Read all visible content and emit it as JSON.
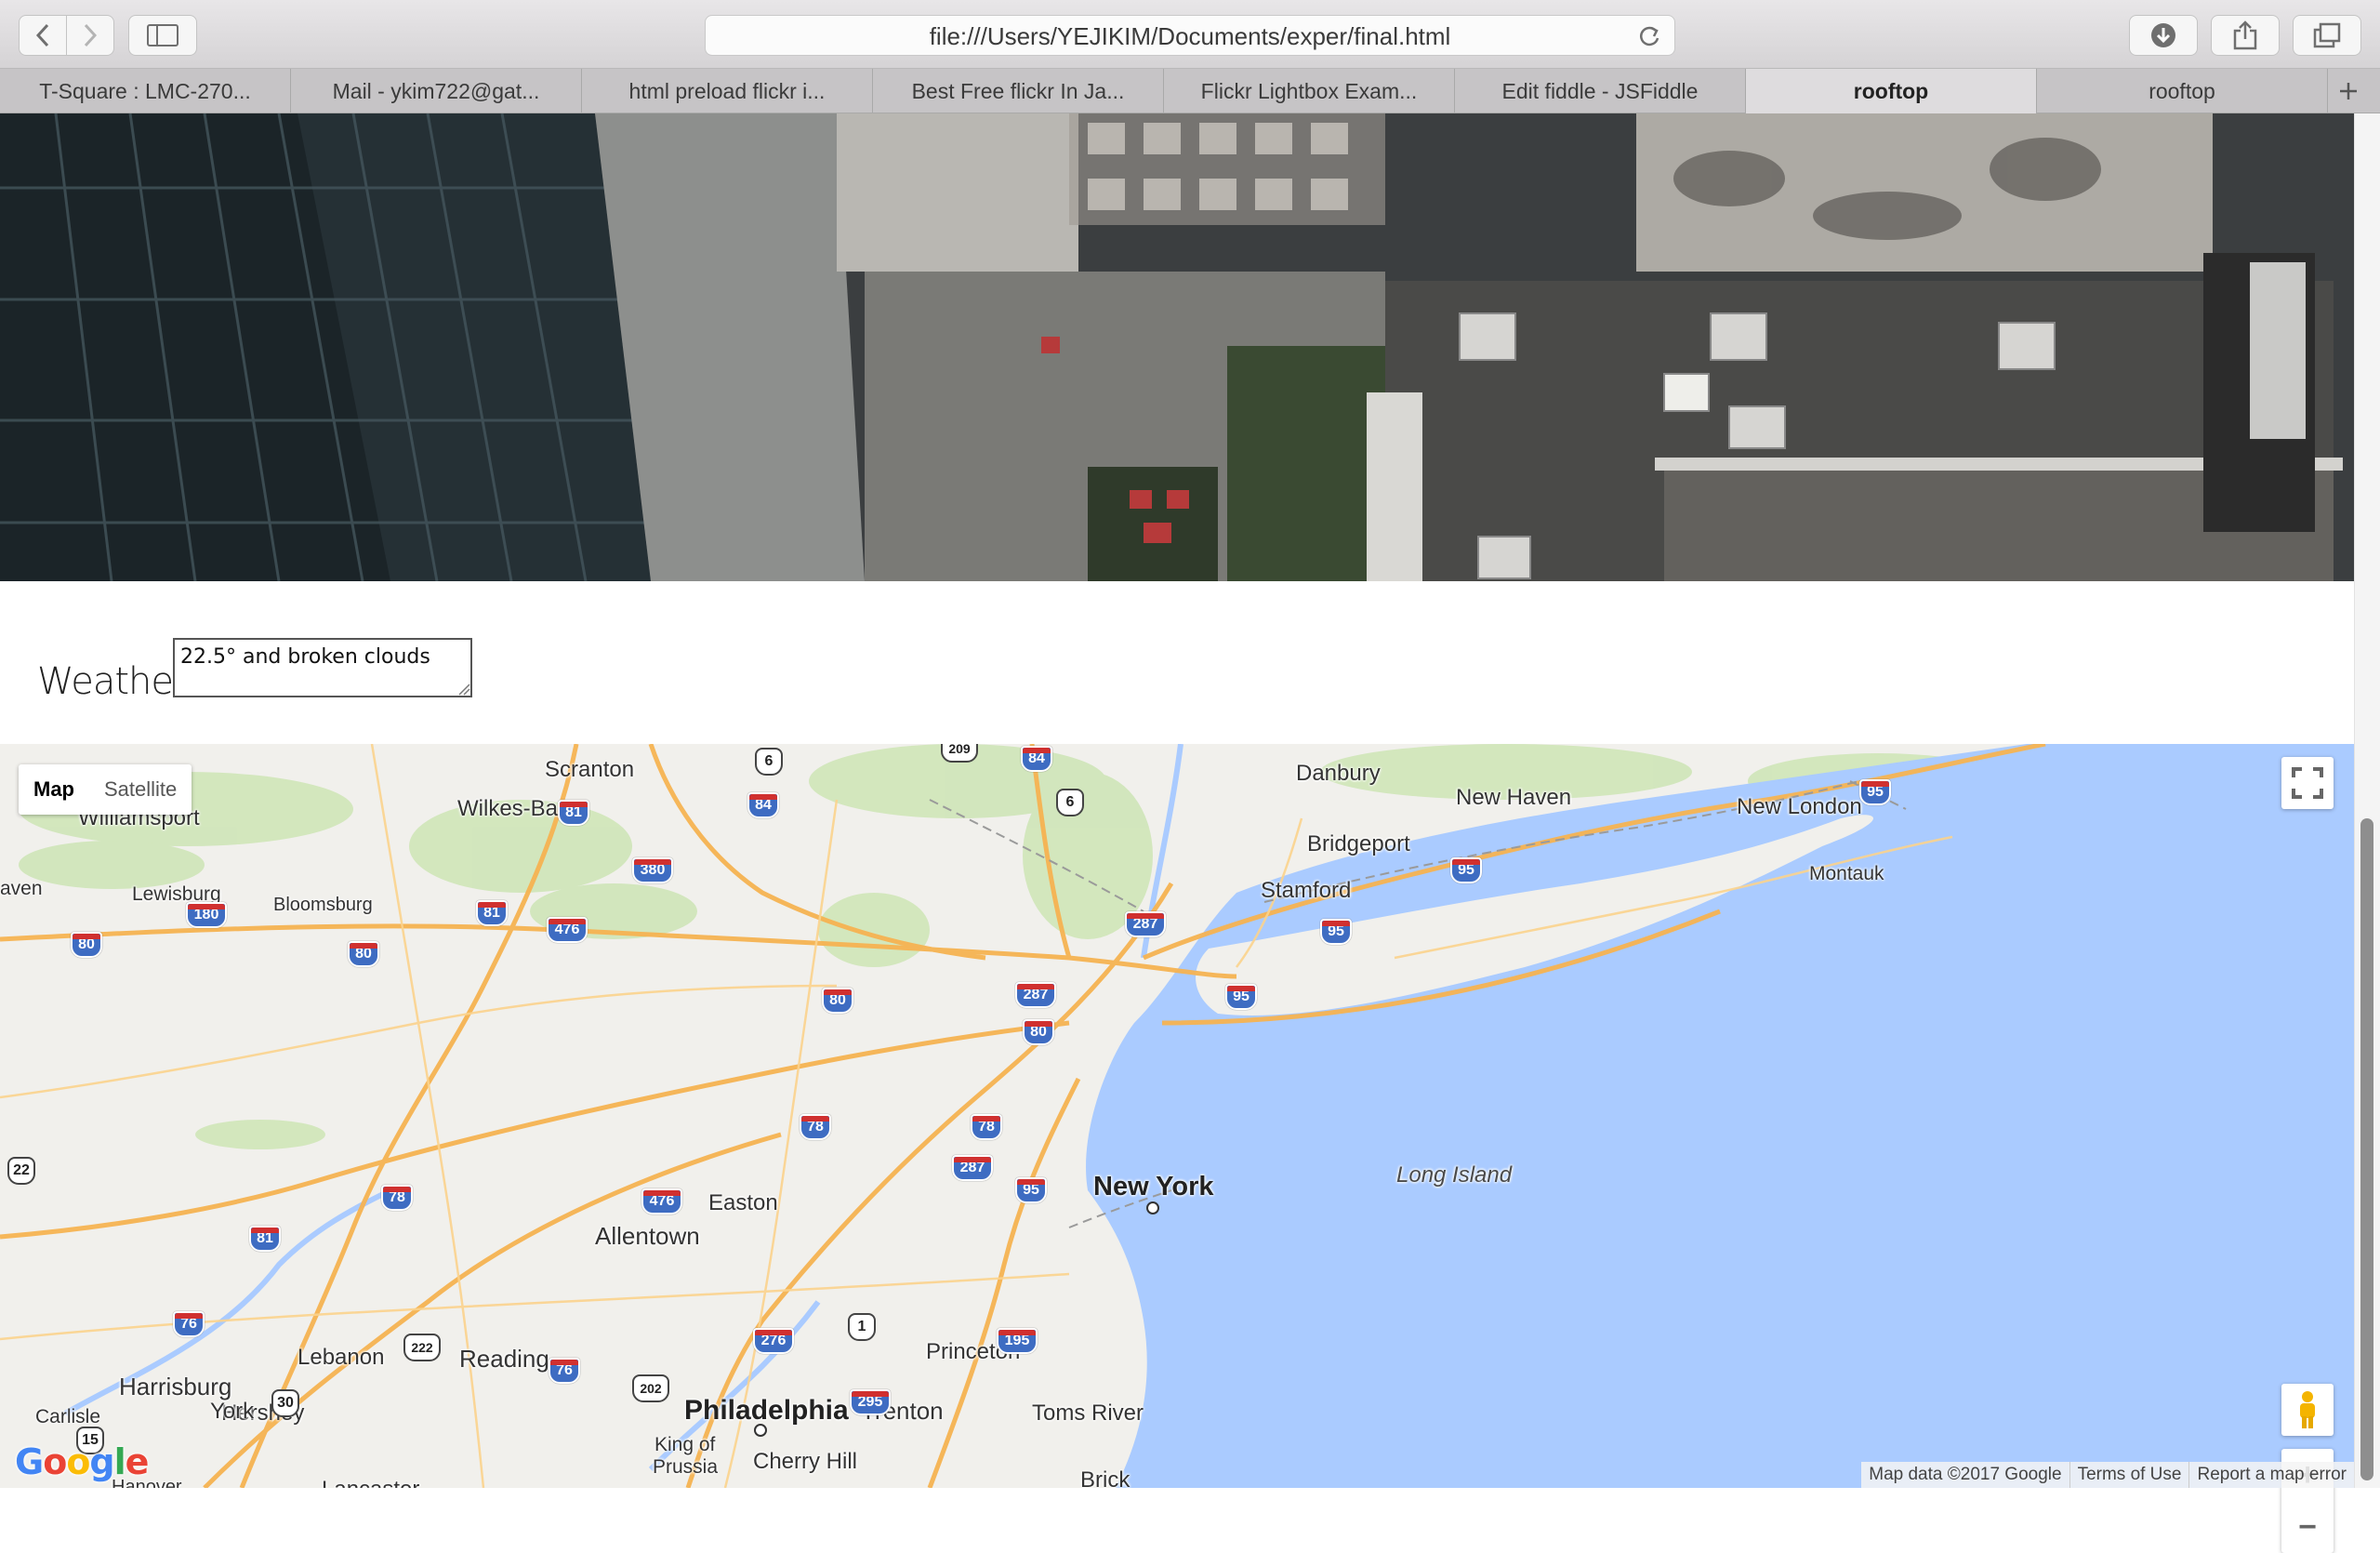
{
  "browser": {
    "url": "file:///Users/YEJIKIM/Documents/exper/final.html",
    "tabs": [
      {
        "label": "T-Square : LMC-270...",
        "active": false
      },
      {
        "label": "Mail - ykim722@gat...",
        "active": false
      },
      {
        "label": "html preload flickr i...",
        "active": false
      },
      {
        "label": "Best Free flickr In Ja...",
        "active": false
      },
      {
        "label": "Flickr Lightbox Exam...",
        "active": false
      },
      {
        "label": "Edit fiddle - JSFiddle",
        "active": false
      },
      {
        "label": "rooftop",
        "active": true
      },
      {
        "label": "rooftop",
        "active": false
      }
    ]
  },
  "weather": {
    "label": "Weather:",
    "value": "22.5° and broken clouds"
  },
  "map": {
    "type_buttons": [
      "Map",
      "Satellite"
    ],
    "selected_type": "Map",
    "cities": {
      "scranton": "Scranton",
      "williamsport": "Williamsport",
      "wilkes_barre": "Wilkes-Barre",
      "danbury": "Danbury",
      "new_haven": "New Haven",
      "new_london": "New London",
      "bridgeport": "Bridgeport",
      "stamford": "Stamford",
      "montauk": "Montauk",
      "lewisburg": "Lewisburg",
      "bloomsburg": "Bloomsburg",
      "new_york": "New York",
      "long_island": "Long Island",
      "easton": "Easton",
      "allentown": "Allentown",
      "harrisburg": "Harrisburg",
      "lebanon": "Lebanon",
      "reading": "Reading",
      "princeton": "Princeton",
      "trenton": "Trenton",
      "carlisle": "Carlisle",
      "hershey": "Hershey",
      "king_of_prussia_1": "King of",
      "king_of_prussia_2": "Prussia",
      "lancaster": "Lancaster",
      "york": "York",
      "philadelphia": "Philadelphia",
      "cherry_hill": "Cherry Hill",
      "brick": "Brick",
      "toms_river": "Toms River",
      "hanover": "Hanover",
      "haven": "aven"
    },
    "shields": {
      "i81a": "81",
      "i84a": "84",
      "i84b": "84",
      "i380": "380",
      "i81b": "81",
      "i476a": "476",
      "i180": "180",
      "i80a": "80",
      "i80b": "80",
      "i80c": "80",
      "i287a": "287",
      "i287b": "287",
      "i80d": "80",
      "i95a": "95",
      "i95b": "95",
      "i95c": "95",
      "i95d": "95",
      "i78a": "78",
      "i78b": "78",
      "i287c": "287",
      "i476b": "476",
      "i78c": "78",
      "i81c": "81",
      "i76a": "76",
      "i276": "276",
      "i195": "195",
      "i76b": "76",
      "i295": "295",
      "i95e": "95"
    },
    "us_shields": {
      "us6a": "6",
      "us6b": "6",
      "us209": "209",
      "us22": "22",
      "us1": "1",
      "us222": "222",
      "us202": "202",
      "us30": "30",
      "us15": "15"
    },
    "attribution": [
      "Map data ©2017 Google",
      "Terms of Use",
      "Report a map error"
    ],
    "logo": "Google",
    "zoom_in": "+",
    "zoom_out": "−"
  },
  "colors": {
    "water": "#aacbff",
    "land": "#f1f0ec",
    "highway": "#f6b352",
    "interstate_shield": "#3e6cc2"
  }
}
